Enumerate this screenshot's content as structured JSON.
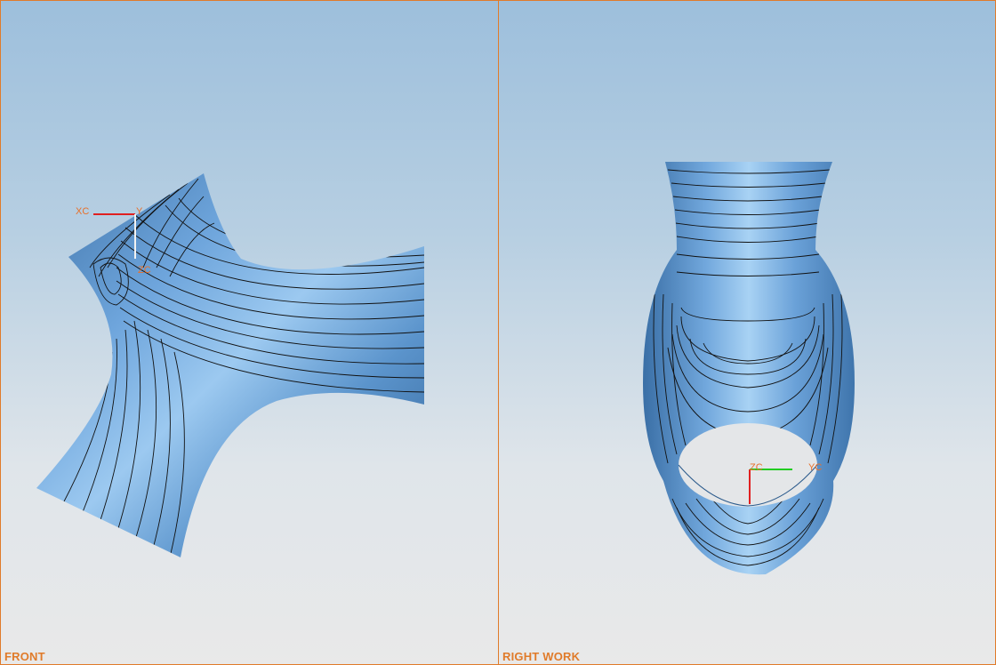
{
  "viewports": [
    {
      "label": "FRONT",
      "axes": {
        "x": "XC",
        "y": "Y",
        "z": "ZC"
      }
    },
    {
      "label": "RIGHT WORK",
      "axes": {
        "z": "ZC",
        "y": "YC"
      }
    }
  ],
  "colors": {
    "border": "#e07b2a",
    "surface": "#5d94cc",
    "contour": "#111111"
  },
  "icons": [
    "wcs-triad-icon",
    "wcs-triad-icon"
  ]
}
